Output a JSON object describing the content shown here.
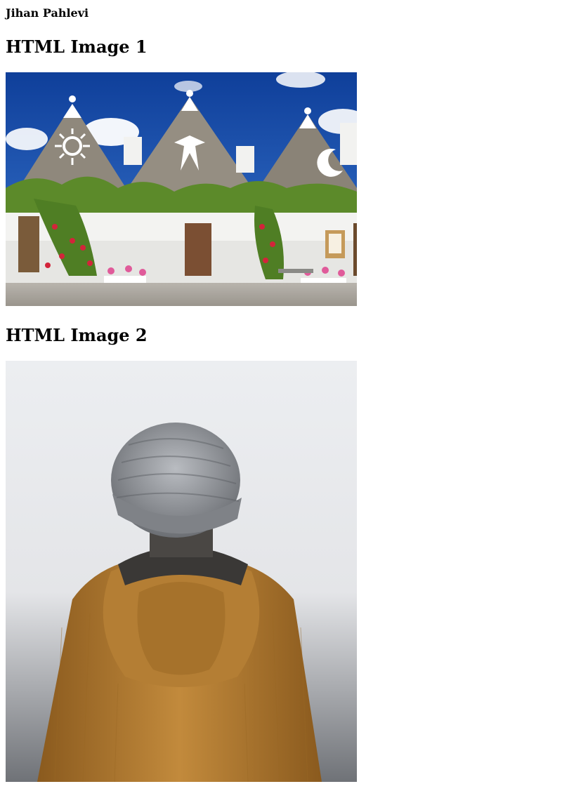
{
  "author": "Jihan Pahlevi",
  "sections": [
    {
      "heading": "HTML Image 1",
      "image_alt": "trulli-houses-photo"
    },
    {
      "heading": "HTML Image 2",
      "image_alt": "person-in-beanie-photo"
    }
  ],
  "colors": {
    "sky": "#1a4fa8",
    "wall": "#f3f3f1",
    "roof": "#8f887c",
    "foliage": "#5c8a2a",
    "jacket": "#b07a2e",
    "beanie": "#8a8d92",
    "fog": "#e4e5e8"
  }
}
